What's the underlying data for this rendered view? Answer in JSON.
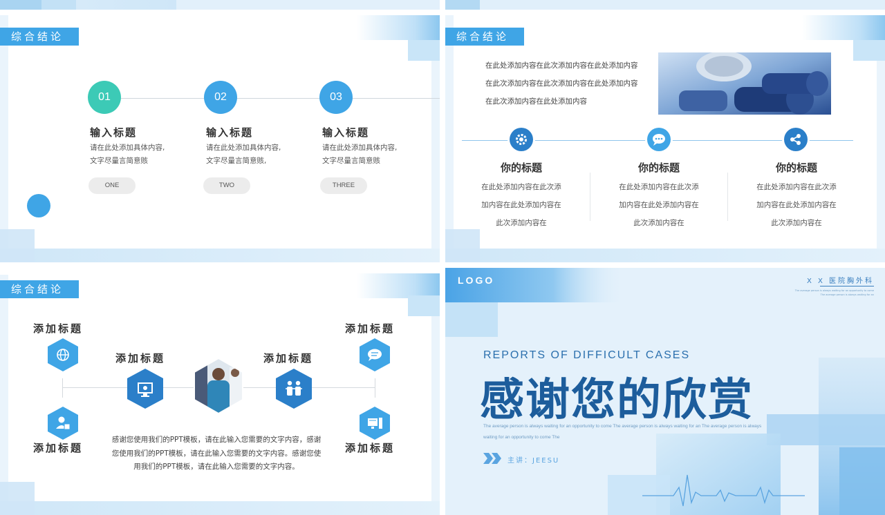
{
  "colors": {
    "accent": "#3fa5e6",
    "teal": "#3ccab6",
    "dark_blue": "#1d5d9c",
    "hex_blue": "#2b7fc9"
  },
  "slide1": {
    "tag": "综合结论",
    "steps": [
      {
        "num": "01",
        "title": "输入标题",
        "desc1": "请在此处添加具体内容,",
        "desc2": "文字尽量言简意赅",
        "pill": "ONE"
      },
      {
        "num": "02",
        "title": "输入标题",
        "desc1": "请在此处添加具体内容,",
        "desc2": "文字尽量言简意赅,",
        "pill": "TWO"
      },
      {
        "num": "03",
        "title": "输入标题",
        "desc1": "请在此处添加具体内容,",
        "desc2": "文字尽量言简意赅",
        "pill": "THREE"
      }
    ]
  },
  "slide2": {
    "tag": "综合结论",
    "intro": "在此处添加内容在此次添加内容在此处添加内容在此次添加内容在此次添加内容在此处添加内容在此次添加内容在此处添加内容",
    "columns": [
      {
        "icon": "gear-icon",
        "title": "你的标题",
        "desc": "在此处添加内容在此次添加内容在此处添加内容在此次添加内容在"
      },
      {
        "icon": "chat-icon",
        "title": "你的标题",
        "desc": "在此处添加内容在此次添加内容在此处添加内容在此次添加内容在"
      },
      {
        "icon": "share-icon",
        "title": "你的标题",
        "desc": "在此处添加内容在此次添加内容在此处添加内容在此次添加内容在"
      }
    ]
  },
  "slide3": {
    "tag": "综合结论",
    "titles": {
      "top_left": "添加标题",
      "bottom_left": "添加标题",
      "mid_left": "添加标题",
      "mid_right": "添加标题",
      "top_right": "添加标题",
      "bottom_right": "添加标题"
    },
    "desc": "感谢您使用我们的PPT模板，请在此输入您需要的文字内容，感谢您使用我们的PPT模板，请在此输入您需要的文字内容。感谢您使用我们的PPT模板，请在此输入您需要的文字内容。"
  },
  "slide4": {
    "logo": "LOGO",
    "hospital": "X X 医院胸外科",
    "tiny": "The average person is always waiting for an opportunity to come The average person is always waiting for an",
    "subtitle": "REPORTS OF DIFFICULT CASES",
    "title": "感谢您的欣赏",
    "para": "The average person is always waiting for an opportunity to come The average person is always waiting for an The average person is always waiting for an opportunity to come The",
    "speaker": "主讲：JEESU"
  }
}
